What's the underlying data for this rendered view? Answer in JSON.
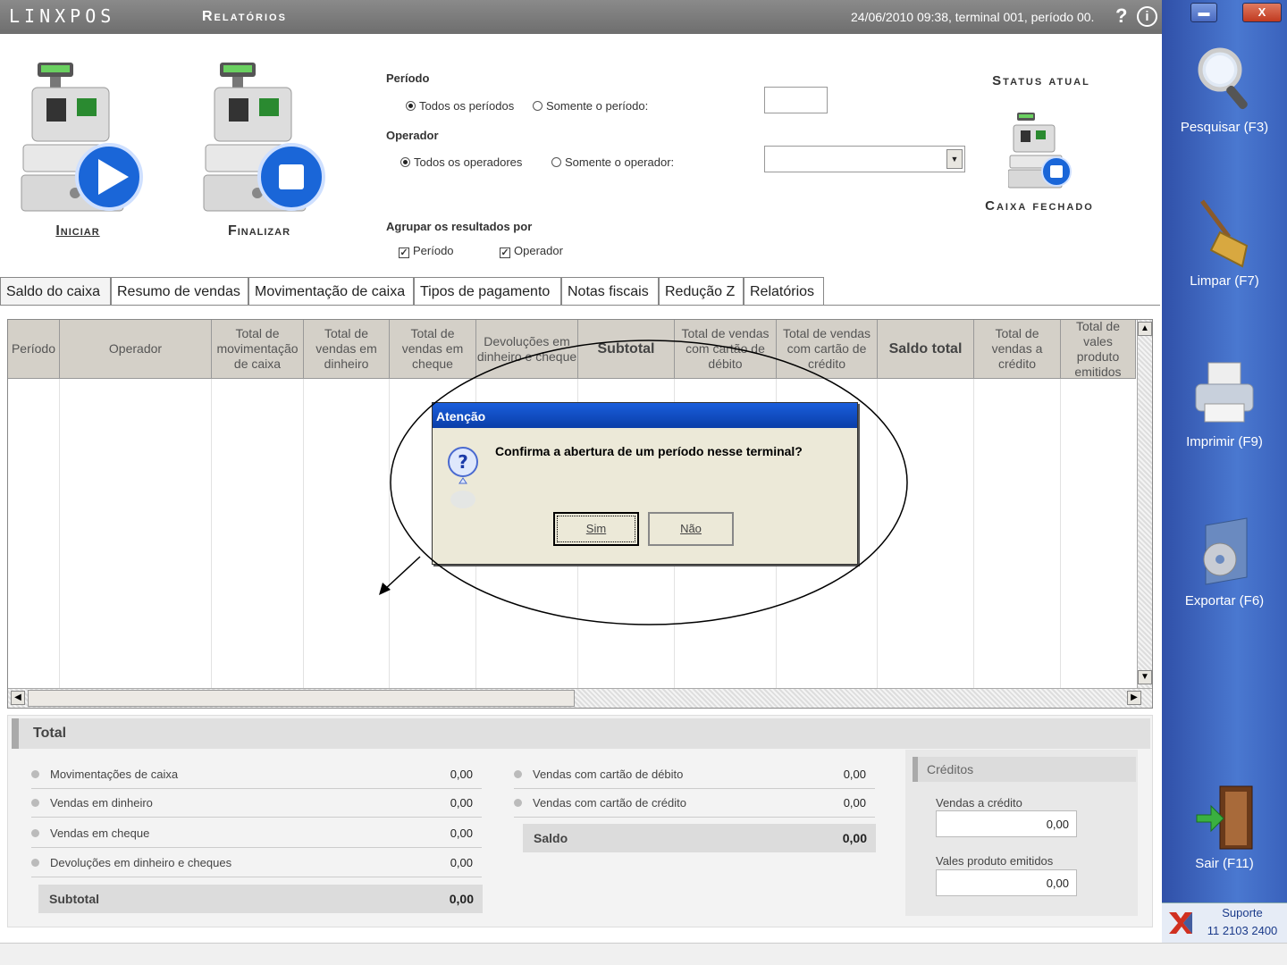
{
  "app": {
    "logo": "LINXPOS",
    "module": "Relatórios",
    "session_info": "24/06/2010 09:38, terminal 001, período 00.",
    "help_symbol": "?",
    "info_symbol": "i",
    "min_symbol": "▬",
    "close_symbol": "X"
  },
  "register": {
    "start_label": "Iniciar",
    "finish_label": "Finalizar"
  },
  "filters": {
    "period_title": "Período",
    "period_all": "Todos os períodos",
    "period_only": "Somente o período:",
    "operator_title": "Operador",
    "operator_all": "Todos os operadores",
    "operator_only": "Somente o operador:",
    "group_title": "Agrupar os resultados por",
    "group_period": "Período",
    "group_operator": "Operador"
  },
  "status": {
    "title": "Status atual",
    "value": "Caixa fechado"
  },
  "sidebar": {
    "search": "Pesquisar (F3)",
    "clear": "Limpar (F7)",
    "print": "Imprimir (F9)",
    "export": "Exportar (F6)",
    "exit": "Sair (F11)",
    "support_label": "Suporte",
    "support_phone": "11 2103 2400"
  },
  "tabs": [
    "Saldo do caixa",
    "Resumo de vendas",
    "Movimentação de caixa",
    "Tipos de pagamento",
    "Notas fiscais",
    "Redução Z",
    "Relatórios"
  ],
  "table": {
    "columns": [
      "Período",
      "Operador",
      "Total de movimentação de caixa",
      "Total de vendas em dinheiro",
      "Total de vendas em cheque",
      "Devoluções em dinheiro e cheque",
      "Subtotal",
      "Total de vendas com cartão de débito",
      "Total de vendas com cartão de crédito",
      "Saldo total",
      "Total de vendas a crédito",
      "Total de vales produto emitidos"
    ]
  },
  "totals": {
    "title": "Total",
    "left": [
      {
        "label": "Movimentações de caixa",
        "value": "0,00"
      },
      {
        "label": "Vendas em dinheiro",
        "value": "0,00"
      },
      {
        "label": "Vendas em cheque",
        "value": "0,00"
      },
      {
        "label": "Devoluções em dinheiro e cheques",
        "value": "0,00"
      }
    ],
    "subtotal_label": "Subtotal",
    "subtotal_value": "0,00",
    "middle": [
      {
        "label": "Vendas com cartão de débito",
        "value": "0,00"
      },
      {
        "label": "Vendas com cartão de crédito",
        "value": "0,00"
      }
    ],
    "saldo_label": "Saldo",
    "saldo_value": "0,00",
    "credits_title": "Créditos",
    "credit_sales_label": "Vendas a crédito",
    "credit_sales_value": "0,00",
    "vouchers_label": "Vales produto emitidos",
    "vouchers_value": "0,00"
  },
  "dialog": {
    "title": "Atenção",
    "message": "Confirma a abertura de um período nesse terminal?",
    "yes": "Sim",
    "no": "Não"
  }
}
